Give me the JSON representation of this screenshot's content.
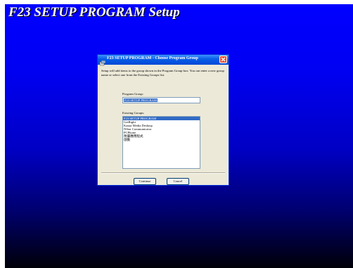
{
  "screen": {
    "title": "F23 SETUP PROGRAM Setup"
  },
  "dialog": {
    "title": "F23 SETUP PROGRAM - Choose Program Group",
    "instructions": "Setup will add items to the group shown in the Program Group box. You can enter a new group name or select one from the Existing Groups list.",
    "program_group_label": "Program Group:",
    "program_group_value": "F23 SETUP PROGRAM",
    "existing_groups_label": "Existing Groups:",
    "existing_groups": [
      "F23 SETUP PROGRAM",
      "GetRight",
      "Kazaa Media Desktop",
      "NStar Communicator",
      "PCPhone",
      "附屬應用程式",
      "啟動"
    ],
    "selected_group_index": 0,
    "continue_label": "Continue",
    "cancel_label": "Cancel"
  },
  "colors": {
    "desktop_top": "#0000ff",
    "desktop_bottom": "#000008",
    "titlebar": "#0a5fe8",
    "selection": "#316ac5",
    "dialog_bg": "#ece9d8"
  },
  "icons": [
    "setup-app-icon",
    "close-icon"
  ]
}
